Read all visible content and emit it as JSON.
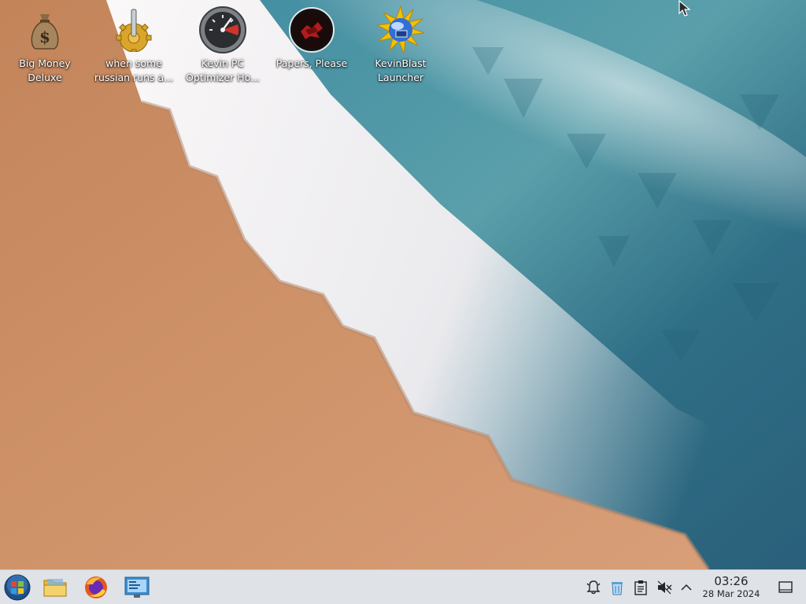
{
  "desktop": {
    "icons": [
      {
        "label": "Big Money\nDeluxe",
        "icon": "money-bag-icon"
      },
      {
        "label": "when some\nrussian runs a...",
        "icon": "gear-lever-icon"
      },
      {
        "label": "Kevin PC\nOptimizer Ho...",
        "icon": "speedometer-icon"
      },
      {
        "label": "Papers, Please",
        "icon": "papers-please-seal-icon"
      },
      {
        "label": "KevinBlast\nLauncher",
        "icon": "kevinblast-sun-icon"
      }
    ]
  },
  "taskbar": {
    "launcher": {
      "icon": "start-orb-icon"
    },
    "pinned": [
      {
        "name": "file-manager",
        "icon": "folder-icon"
      },
      {
        "name": "firefox",
        "icon": "firefox-icon"
      },
      {
        "name": "system-settings",
        "icon": "settings-monitor-icon"
      }
    ],
    "tray": [
      {
        "name": "notifications",
        "icon": "bell-icon"
      },
      {
        "name": "recycle-bin",
        "icon": "trash-icon"
      },
      {
        "name": "clipboard",
        "icon": "clipboard-icon"
      },
      {
        "name": "volume-muted",
        "icon": "speaker-muted-icon"
      },
      {
        "name": "show-hidden",
        "icon": "chevron-up-icon"
      }
    ],
    "clock": {
      "time": "03:26",
      "date": "28 Mar 2024"
    },
    "show_desktop": {
      "icon": "show-desktop-icon"
    }
  },
  "colors": {
    "sand": "#c98a5e",
    "foam": "#f1eef0",
    "sea": "#2f7d8f",
    "taskbar": "#dfe2e6"
  }
}
